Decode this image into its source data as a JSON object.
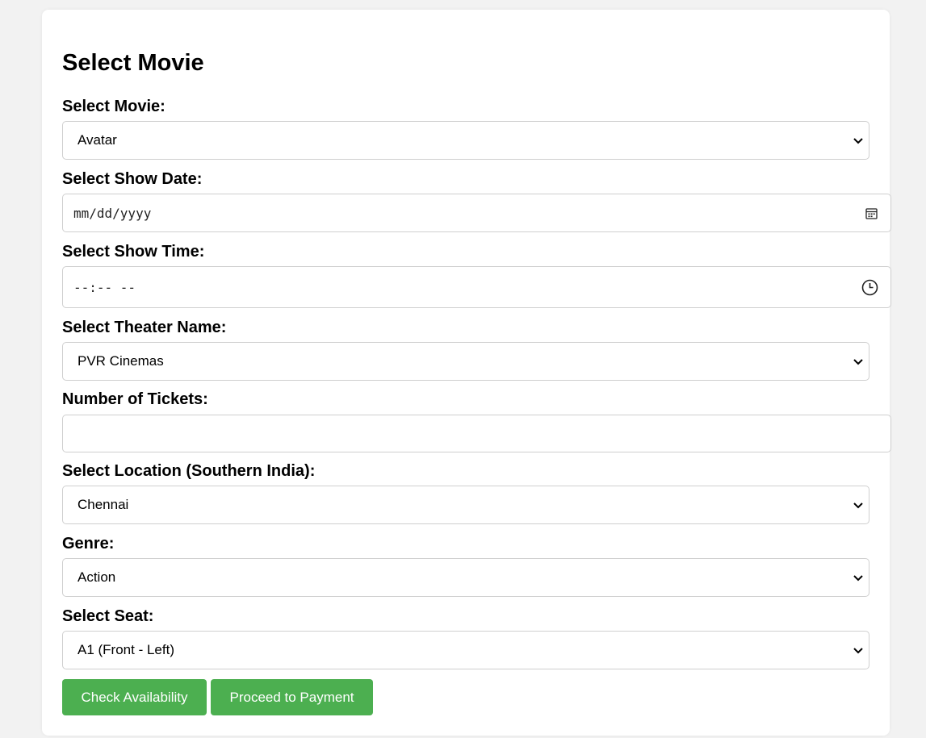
{
  "form": {
    "title": "Select Movie",
    "movie": {
      "label": "Select Movie:",
      "value": "Avatar"
    },
    "show_date": {
      "label": "Select Show Date:",
      "placeholder": "mm/dd/yyyy"
    },
    "show_time": {
      "label": "Select Show Time:",
      "placeholder": "--:-- --"
    },
    "theater": {
      "label": "Select Theater Name:",
      "value": "PVR Cinemas"
    },
    "tickets": {
      "label": "Number of Tickets:",
      "value": ""
    },
    "location": {
      "label": "Select Location (Southern India):",
      "value": "Chennai"
    },
    "genre": {
      "label": "Genre:",
      "value": "Action"
    },
    "seat": {
      "label": "Select Seat:",
      "value": "A1 (Front - Left)"
    }
  },
  "buttons": {
    "check_label": "Check Availability",
    "proceed_label": "Proceed to Payment"
  },
  "icons": {
    "select_arrow": "chevron-down-icon",
    "date": "calendar-icon",
    "time": "clock-icon"
  },
  "colors": {
    "accent": "#4caf50",
    "background": "#f2f2f2",
    "card": "#ffffff",
    "border": "#cfcfcf"
  }
}
